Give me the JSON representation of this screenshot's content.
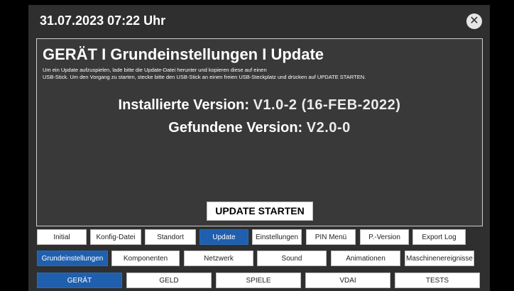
{
  "header": {
    "datetime": "31.07.2023 07:22 Uhr",
    "close_icon": "close-icon",
    "close_glyph": "✕"
  },
  "panel": {
    "title": "GERÄT I Grundeinstellungen I Update",
    "description_line1": "Um ein Update aufzuspielen, lade bitte die Update-Datei herunter und kopieren diese auf einen",
    "description_line2": "USB-Stick. Um den Vorgang zu starten, stecke bitte den USB-Stick an einen freien USB-Steckplatz und drücken auf UPDATE STARTEN.",
    "installed_label": "Installierte Version:",
    "installed_value": "V1.0-2 (16-FEB-2022)",
    "found_label": "Gefundene Version:",
    "found_value": "V2.0-0",
    "start_button": "UPDATE STARTEN"
  },
  "tabs_row1": [
    {
      "label": "Initial",
      "active": false
    },
    {
      "label": "Konfig-Datei",
      "active": false
    },
    {
      "label": "Standort",
      "active": false
    },
    {
      "label": "Update",
      "active": true
    },
    {
      "label": "Einstellungen",
      "active": false
    },
    {
      "label": "PIN Menü",
      "active": false
    },
    {
      "label": "P.-Version",
      "active": false
    },
    {
      "label": "Export Log",
      "active": false
    }
  ],
  "tabs_row2": [
    {
      "label": "Grundeinstellungen",
      "active": true
    },
    {
      "label": "Komponenten",
      "active": false
    },
    {
      "label": "Netzwerk",
      "active": false
    },
    {
      "label": "Sound",
      "active": false
    },
    {
      "label": "Animationen",
      "active": false
    },
    {
      "label": "Maschinenereignisse",
      "active": false
    }
  ],
  "tabs_row3": [
    {
      "label": "GERÄT",
      "active": true
    },
    {
      "label": "GELD",
      "active": false
    },
    {
      "label": "SPIELE",
      "active": false
    },
    {
      "label": "VDAI",
      "active": false
    },
    {
      "label": "TESTS",
      "active": false
    }
  ],
  "colors": {
    "background": "#2f2f2f",
    "panel": "#393939",
    "active_tab": "#1f5fae",
    "tab": "#ffffff"
  }
}
